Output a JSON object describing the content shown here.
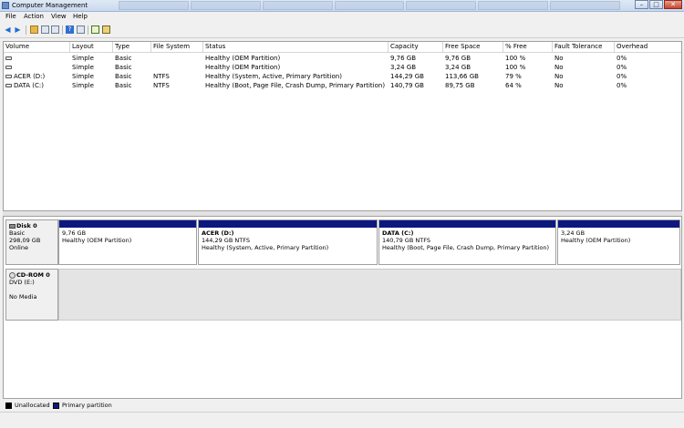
{
  "window": {
    "title": "Computer Management"
  },
  "menu": [
    "File",
    "Action",
    "View",
    "Help"
  ],
  "volumes": {
    "columns": [
      "Volume",
      "Layout",
      "Type",
      "File System",
      "Status",
      "Capacity",
      "Free Space",
      "% Free",
      "Fault Tolerance",
      "Overhead"
    ],
    "rows": [
      {
        "volume": "",
        "layout": "Simple",
        "type": "Basic",
        "fs": "",
        "status": "Healthy (OEM Partition)",
        "capacity": "9,76 GB",
        "free": "9,76 GB",
        "pct": "100 %",
        "fault": "No",
        "overhead": "0%"
      },
      {
        "volume": "",
        "layout": "Simple",
        "type": "Basic",
        "fs": "",
        "status": "Healthy (OEM Partition)",
        "capacity": "3,24 GB",
        "free": "3,24 GB",
        "pct": "100 %",
        "fault": "No",
        "overhead": "0%"
      },
      {
        "volume": "ACER (D:)",
        "layout": "Simple",
        "type": "Basic",
        "fs": "NTFS",
        "status": "Healthy (System, Active, Primary Partition)",
        "capacity": "144,29 GB",
        "free": "113,66 GB",
        "pct": "79 %",
        "fault": "No",
        "overhead": "0%"
      },
      {
        "volume": "DATA (C:)",
        "layout": "Simple",
        "type": "Basic",
        "fs": "NTFS",
        "status": "Healthy (Boot, Page File, Crash Dump, Primary Partition)",
        "capacity": "140,79 GB",
        "free": "89,75 GB",
        "pct": "64 %",
        "fault": "No",
        "overhead": "0%"
      }
    ]
  },
  "disk0": {
    "name": "Disk 0",
    "type": "Basic",
    "size": "298,09 GB",
    "state": "Online",
    "partitions": [
      {
        "name": "",
        "size": "9,76 GB",
        "status": "Healthy (OEM Partition)"
      },
      {
        "name": "ACER  (D:)",
        "size": "144,29 GB NTFS",
        "status": "Healthy (System, Active, Primary Partition)"
      },
      {
        "name": "DATA  (C:)",
        "size": "140,79 GB NTFS",
        "status": "Healthy (Boot, Page File, Crash Dump, Primary Partition)"
      },
      {
        "name": "",
        "size": "3,24 GB",
        "status": "Healthy (OEM Partition)"
      }
    ]
  },
  "cdrom0": {
    "name": "CD-ROM 0",
    "drive": "DVD (E:)",
    "state": "No Media"
  },
  "legend": [
    {
      "label": "Unallocated",
      "color": "#000000"
    },
    {
      "label": "Primary partition",
      "color": "#0c1880"
    }
  ],
  "colors": {
    "partition_bar": "#0c1880",
    "title_bar": "#c9d9ee"
  }
}
